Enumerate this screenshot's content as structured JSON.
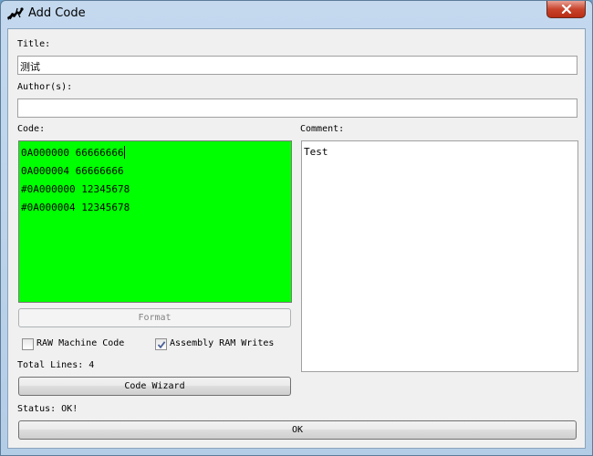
{
  "window": {
    "title": "Add Code"
  },
  "form": {
    "title_label": "Title:",
    "title_value": "测试",
    "author_label": "Author(s):",
    "author_value": "",
    "code_label": "Code:",
    "code_lines": [
      "0A000000 66666666",
      "0A000004 66666666",
      "#0A000000 12345678",
      "#0A000004 12345678"
    ],
    "comment_label": "Comment:",
    "comment_value": "Test",
    "format_button": "Format",
    "raw_machine_code_label": "RAW Machine Code",
    "raw_machine_code_checked": false,
    "assembly_ram_writes_label": "Assembly RAM Writes",
    "assembly_ram_writes_checked": true,
    "total_lines": "Total Lines: 4",
    "code_wizard_button": "Code Wizard",
    "status": "Status: OK!",
    "ok_button": "OK"
  },
  "colors": {
    "code_background": "#00ff00",
    "close_button": "#c8442c"
  }
}
